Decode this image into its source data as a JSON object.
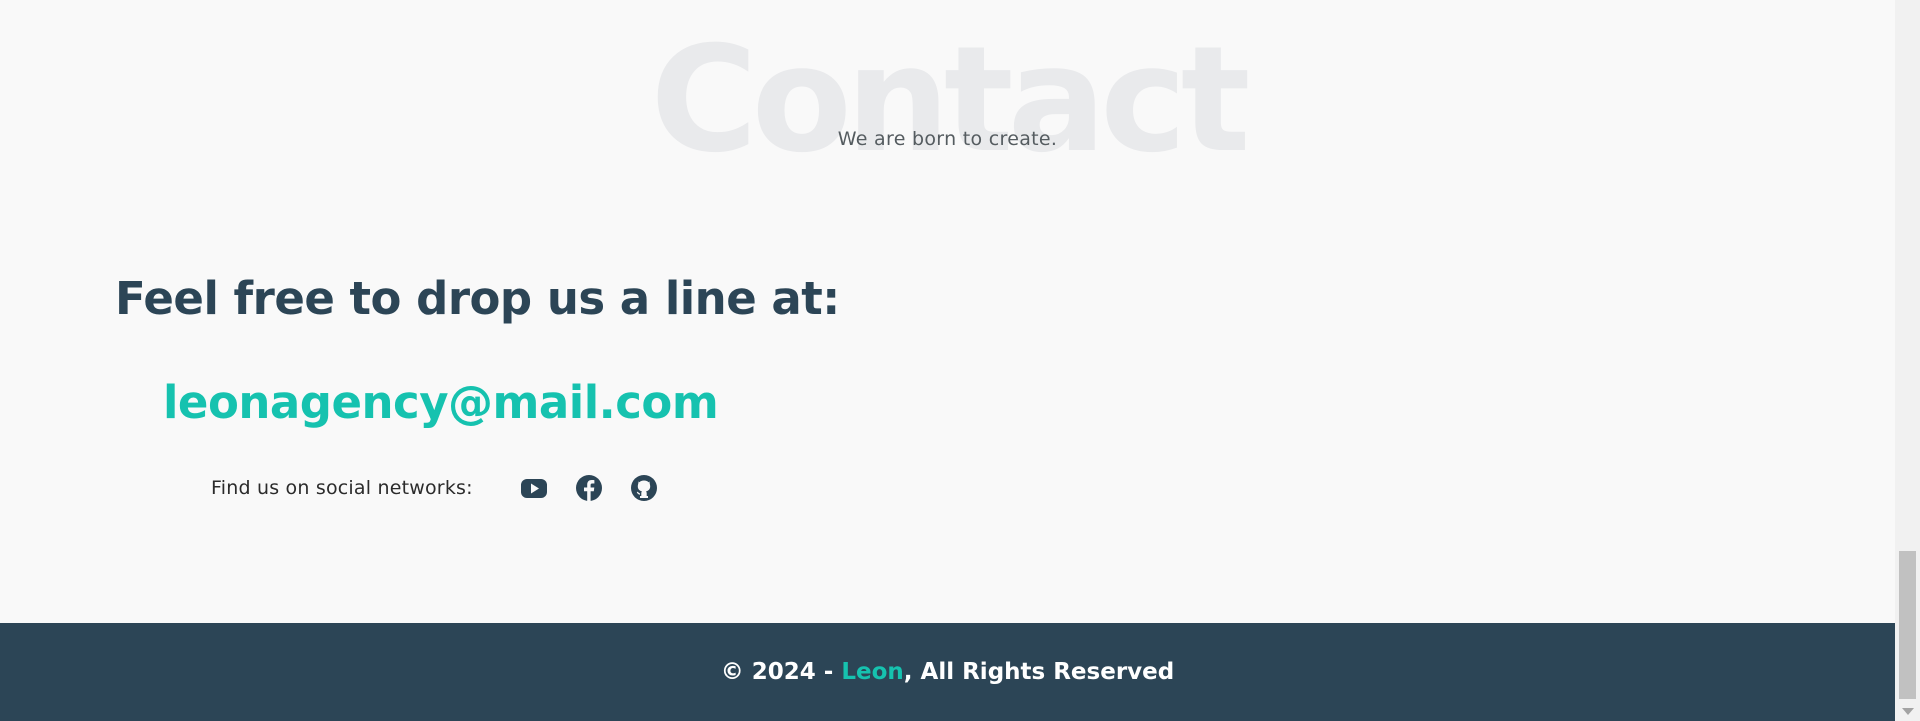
{
  "contact": {
    "bg_title": "Contact",
    "subtitle": "We are born to create."
  },
  "main": {
    "headline": "Feel free to drop us a line at:",
    "email": "leonagency@mail.com",
    "social_label": "Find us on social networks:",
    "social_icons": [
      "youtube-icon",
      "facebook-icon",
      "github-icon"
    ]
  },
  "footer": {
    "prefix": "© 2024 - ",
    "brand": "Leon",
    "suffix": ", All Rights Reserved"
  },
  "colors": {
    "dark": "#2c4556",
    "accent": "#16c2af",
    "background": "#f9f9f9"
  }
}
